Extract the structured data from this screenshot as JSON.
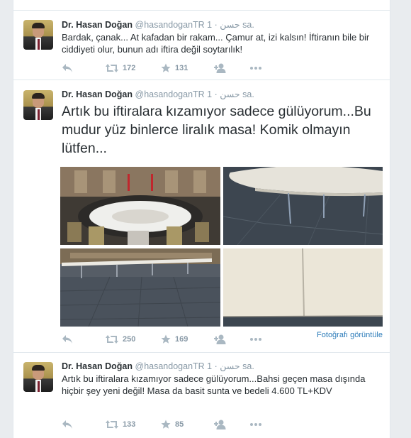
{
  "tweets": [
    {
      "name": "Dr. Hasan Doğan",
      "handle": "@hasandoganTR",
      "arabic": "حسن",
      "time": "1 sa.",
      "text": "Bardak, çanak... At kafadan bir rakam... Çamur at, izi kalsın! İftiranın bile bir ciddiyeti olur, bunun adı iftira değil soytarılık!",
      "retweets": "172",
      "favorites": "131"
    },
    {
      "name": "Dr. Hasan Doğan",
      "handle": "@hasandoganTR",
      "arabic": "حسن",
      "time": "1 sa.",
      "text": "Artık bu iftiralara kızamıyor sadece gülüyorum...Bu mudur yüz binlerce liralık masa! Komik olmayın lütfen...",
      "retweets": "250",
      "favorites": "169",
      "view_photo": "Fotoğrafı görüntüle"
    },
    {
      "name": "Dr. Hasan Doğan",
      "handle": "@hasandoganTR",
      "arabic": "حسن",
      "time": "1 sa.",
      "text": "Artık bu iftiralara kızamıyor sadece gülüyorum...Bahsi geçen masa dışında hiçbir şey yeni değil! Masa da basit sunta ve bedeli 4.600 TL+KDV",
      "retweets": "133",
      "favorites": "85"
    }
  ],
  "icons": {
    "reply": "reply-icon",
    "retweet": "retweet-icon",
    "favorite": "star-icon",
    "follow": "follow-icon",
    "more": "more-icon"
  },
  "colors": {
    "text": "#292f33",
    "muted": "#8899a6",
    "link": "#2b7bb9",
    "border": "#e1e8ed"
  }
}
